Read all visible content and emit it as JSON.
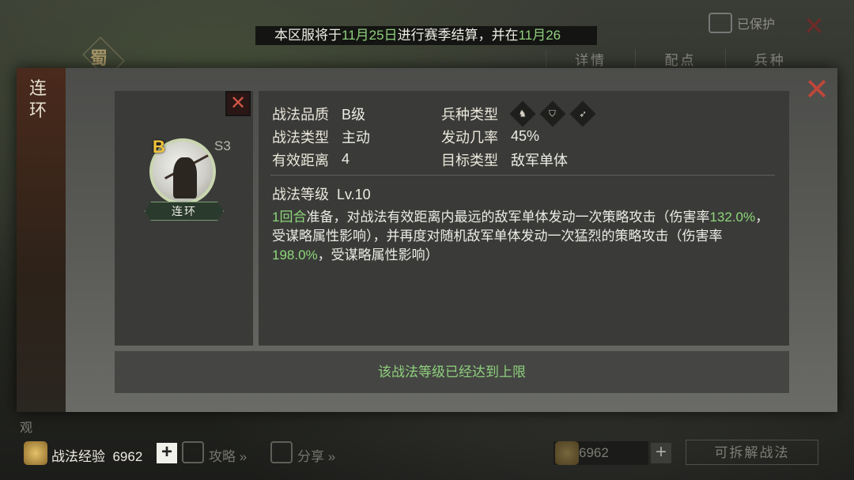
{
  "background": {
    "shu_label": "蜀",
    "protect_label": "已保护",
    "tabs": [
      "详情",
      "配点",
      "兵种"
    ],
    "guan_label": "观"
  },
  "notice": {
    "prefix": "本区服将于",
    "date1": "11月25日",
    "middle": "进行赛季结算，并在",
    "date2": "11月26"
  },
  "panel": {
    "side_title": "连环",
    "skill_card": {
      "grade": "B",
      "season": "S3",
      "name": "连环"
    },
    "attributes": {
      "quality_label": "战法品质",
      "quality_value": "B级",
      "type_label": "战法类型",
      "type_value": "主动",
      "range_label": "有效距离",
      "range_value": "4",
      "arms_label": "兵种类型",
      "arms_icons": [
        "cavalry-icon",
        "shield-icon",
        "bow-icon"
      ],
      "rate_label": "发动几率",
      "rate_value": "45%",
      "target_label": "目标类型",
      "target_value": "敌军单体"
    },
    "level_label": "战法等级",
    "level_value": "Lv.10",
    "description": {
      "p1_green": "1回合",
      "p1": "准备，对战法有效距离内最远的敌军单体发动一次策略攻击（伤害率",
      "p2_green": "132.0%",
      "p2": "，受谋略属性影响），并再度对随机敌军单体发动一次猛烈的策略攻击（伤害率",
      "p3_green": "198.0%",
      "p3": "，受谋略属性影响）"
    },
    "max_level_note": "该战法等级已经达到上限"
  },
  "footer": {
    "exp_label": "战法经验",
    "exp_value": "6962",
    "strategy_label": "攻略 »",
    "share_label": "分享 »",
    "right_exp_value": "6962",
    "dismantle_label": "可拆解战法"
  },
  "colors": {
    "accent_green": "#8fcf7e",
    "close_red": "#c0463a",
    "grade_gold": "#f1c43b"
  }
}
